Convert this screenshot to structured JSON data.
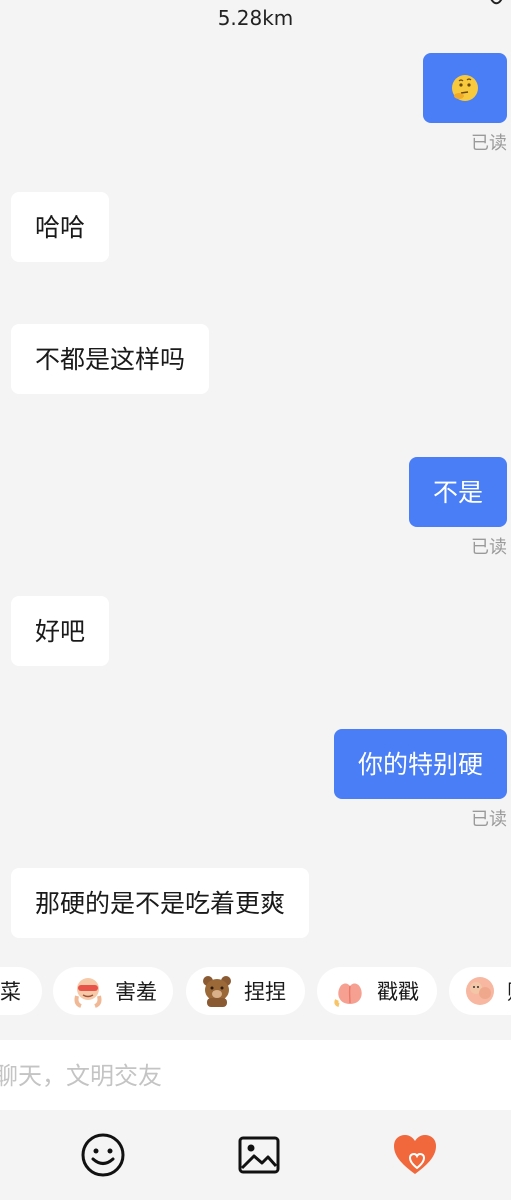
{
  "header": {
    "distance": "5.28km"
  },
  "messages": [
    {
      "side": "out",
      "type": "emoji",
      "emoji": "thinking-face",
      "read": "已读"
    },
    {
      "side": "in",
      "text": "哈哈"
    },
    {
      "side": "in",
      "text": "不都是这样吗"
    },
    {
      "side": "out",
      "text": "不是",
      "read": "已读"
    },
    {
      "side": "in",
      "text": "好吧"
    },
    {
      "side": "out",
      "text": "你的特别硬",
      "read": "已读"
    },
    {
      "side": "in",
      "text": "那硬的是不是吃着更爽"
    }
  ],
  "quick_actions": [
    {
      "label": "菜",
      "icon": ""
    },
    {
      "label": "害羞",
      "icon": "shy-face-icon"
    },
    {
      "label": "捏捏",
      "icon": "bear-icon"
    },
    {
      "label": "戳戳",
      "icon": "peach-icon"
    },
    {
      "label": "贴",
      "icon": "hug-icon"
    }
  ],
  "input": {
    "placeholder": "聊天，文明交友"
  },
  "toolbar": {
    "icons": [
      "smile-icon",
      "image-icon",
      "heart-icon"
    ]
  },
  "colors": {
    "outgoing": "#4a7ef7",
    "incoming": "#ffffff",
    "background": "#f4f4f4",
    "accent": "#f0683c"
  }
}
